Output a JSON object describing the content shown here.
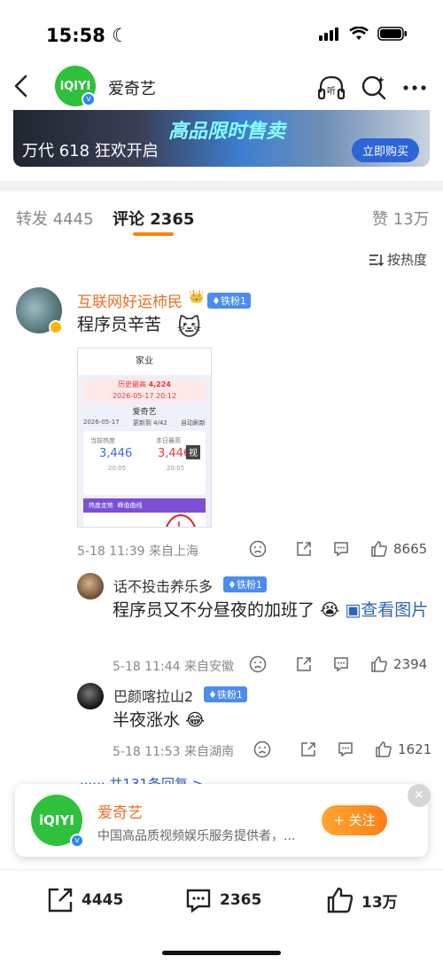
{
  "status_bar": {
    "time": "15:58"
  },
  "header": {
    "account_name": "爱奇艺",
    "logo_text": "iQIYI"
  },
  "banner": {
    "left_text": "万代 618 狂欢开启",
    "middle_text": "高品限时售卖",
    "button_label": "立即购买"
  },
  "tabs": [
    {
      "label": "转发",
      "count": "4445"
    },
    {
      "label": "评论",
      "count": "2365"
    },
    {
      "label": "赞",
      "count": "13万"
    }
  ],
  "sort_label": "按热度",
  "comment": {
    "username": "互联网好运柿民",
    "fan_badge": "铁粉1",
    "content": "程序员辛苦",
    "image": {
      "title": "家业",
      "record_label": "历史最高",
      "record_value": "4,224",
      "record_date": "2026-05-17 20:12",
      "app_name": "爱奇艺",
      "date_value": "2026-05-17",
      "update_text": "更新到 4/42",
      "auto_refresh": "自动刷新",
      "current_label": "当前热度",
      "current_value": "3,446",
      "current_time": "20:05",
      "today_label": "本日最高",
      "today_value": "3,446",
      "today_time": "20:05",
      "chart_tab1": "热度走势",
      "chart_tab2": "峰值曲线",
      "watermark": "视"
    },
    "time": "5-18 11:39",
    "location": "来自上海",
    "likes": "8665",
    "replies": [
      {
        "username": "话不投击养乐多",
        "fan_badge": "铁粉1",
        "content": "程序员又不分昼夜的加班了",
        "link_text": "查看图片",
        "time": "5-18 11:44",
        "location": "来自安徽",
        "likes": "2394"
      },
      {
        "username": "巴颜喀拉山2",
        "fan_badge": "铁粉1",
        "content": "半夜涨水",
        "time": "5-18 11:53",
        "location": "来自湖南",
        "likes": "1621"
      }
    ],
    "more_replies": "共131条回复 >"
  },
  "promo": {
    "name": "爱奇艺",
    "description": "中国高品质视频娱乐服务提供者，...",
    "follow_label": "+ 关注",
    "logo_text": "iQIYI"
  },
  "bottom_bar": {
    "repost_count": "4445",
    "comment_count": "2365",
    "like_count": "13万"
  }
}
